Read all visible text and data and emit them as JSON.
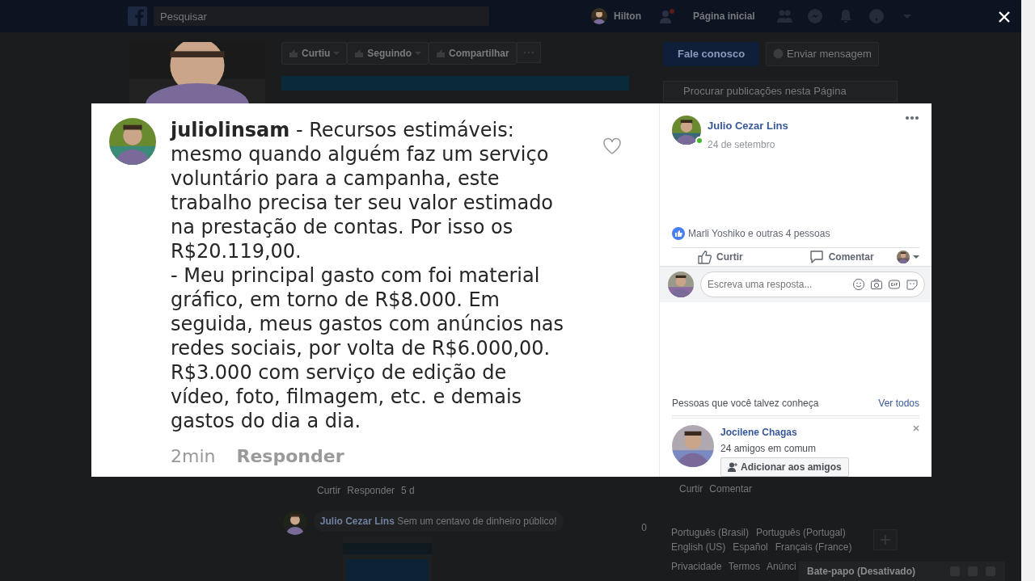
{
  "topbar": {
    "search_placeholder": "Pesquisar",
    "user": "Hilton",
    "home": "Página inicial"
  },
  "page_actions": [
    {
      "label": "Curtiu",
      "kind": "dropdown"
    },
    {
      "label": "Seguindo",
      "kind": "dropdown"
    },
    {
      "label": "Compartilhar",
      "kind": "plain"
    }
  ],
  "page_contact": {
    "primary": "Fale conosco",
    "secondary": "Enviar mensagem"
  },
  "page_search": {
    "placeholder": "Procurar publicações nesta Página"
  },
  "viewer": {
    "photo": {
      "paragraphs": [
        "**juliolinsam** - Recursos estimáveis: mesmo quando alguém faz um serviço voluntário para a campanha, este trabalho precisa ter seu valor estimado na prestação de contas. Por isso os R$20.119,00.",
        "- Meu principal gasto com foi material gráfico, em torno de R$8.000. Em seguida, meus gastos com anúncios nas redes sociais, por volta de R$6.000,00. R$3.000 com serviço de edição de vídeo, foto, filmagem, etc. e demais gastos do dia a dia."
      ],
      "time": "2min",
      "reply": "Responder",
      "liked": false
    },
    "author": "Julio Cezar Lins",
    "date": "24 de setembro",
    "online": true,
    "reactions": "Marli Yoshiko e outras 4 pessoas",
    "actions": [
      {
        "label": "Curtir",
        "kind": "like"
      },
      {
        "label": "Comentar",
        "kind": "comment"
      }
    ],
    "reply_placeholder": "Escreva uma resposta...",
    "suggestions": {
      "title": "Pessoas que você talvez conheça",
      "see_all": "Ver todos",
      "people": [
        {
          "name": "Jocilene Chagas",
          "mutual": "24 amigos em comum",
          "button": "Adicionar aos amigos"
        }
      ]
    }
  },
  "background_feed": {
    "comment_actions": [
      "Curtir",
      "Responder",
      "5 d"
    ],
    "comment": {
      "author": "Julio Cezar Lins",
      "text": "Sem um centavo de dinheiro público!",
      "votes": "0"
    },
    "post_actions": [
      "Curtir",
      "Comentar"
    ]
  },
  "languages": [
    "Português (Brasil)",
    "Português (Portugal)",
    "English (US)",
    "Español",
    "Français (France)"
  ],
  "footer_links": [
    "Privacidade",
    "Termos",
    "Anúnci"
  ],
  "chat": {
    "label": "Bate-papo (Desativado)"
  }
}
